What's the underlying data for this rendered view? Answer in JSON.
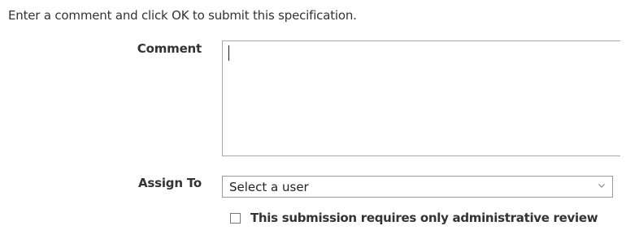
{
  "instruction": "Enter a comment and click OK to submit this specification.",
  "comment": {
    "label": "Comment",
    "value": ""
  },
  "assign_to": {
    "label": "Assign To",
    "selected": "Select a user"
  },
  "admin_review": {
    "label": "This submission requires only administrative review",
    "checked": false
  },
  "icons": {
    "select_arrow": "chevron-down-icon"
  },
  "colors": {
    "text": "#333333",
    "border": "#aaaaaa",
    "background": "#ffffff"
  }
}
